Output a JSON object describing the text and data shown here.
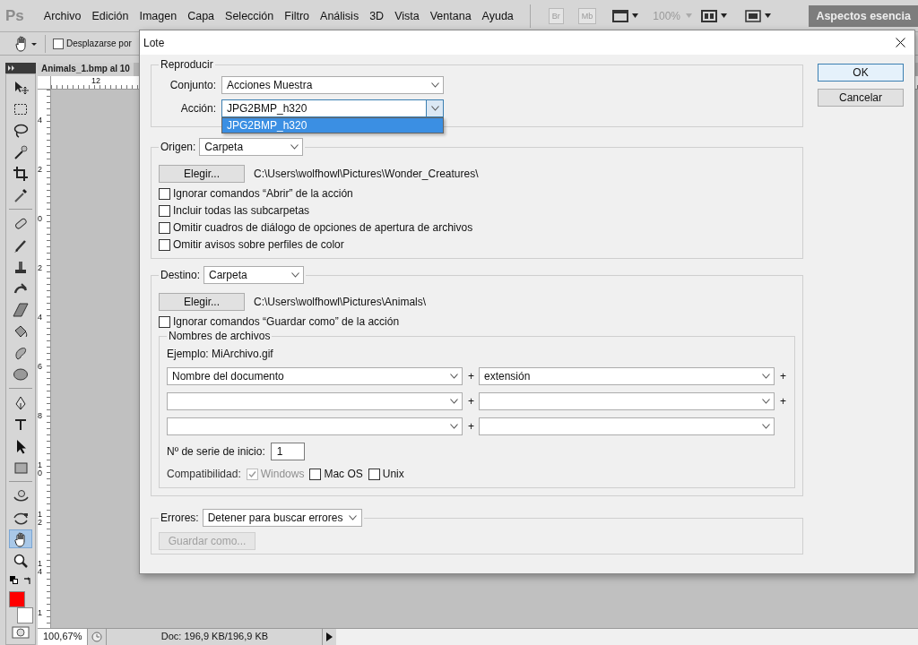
{
  "menubar": {
    "logo": "Ps",
    "menu": [
      "Archivo",
      "Edición",
      "Imagen",
      "Capa",
      "Selección",
      "Filtro",
      "Análisis",
      "3D",
      "Vista",
      "Ventana",
      "Ayuda"
    ],
    "app_buttons": [
      "Br",
      "Mb"
    ],
    "zoom": "100%",
    "workspace": "Aspectos esencia"
  },
  "options_bar": {
    "checkbox": {
      "label": "Desplazarse por",
      "checked": false
    }
  },
  "tools": [
    {
      "kind": "move",
      "selected": false
    },
    {
      "kind": "marquee",
      "selected": false
    },
    {
      "kind": "lasso",
      "selected": false
    },
    {
      "kind": "wand",
      "selected": false
    },
    {
      "kind": "crop",
      "selected": false
    },
    {
      "kind": "eyedropper",
      "selected": false
    },
    {
      "kind": "healing",
      "selected": false
    },
    {
      "kind": "brush",
      "selected": false
    },
    {
      "kind": "stamp",
      "selected": false
    },
    {
      "kind": "history",
      "selected": false
    },
    {
      "kind": "eraser",
      "selected": false
    },
    {
      "kind": "bucket",
      "selected": false
    },
    {
      "kind": "smudge",
      "selected": false
    },
    {
      "kind": "sponge",
      "selected": false
    },
    {
      "kind": "pen",
      "selected": false
    },
    {
      "kind": "type",
      "selected": false
    },
    {
      "kind": "path-select",
      "selected": false
    },
    {
      "kind": "shape",
      "selected": false
    },
    {
      "kind": "rotate3d",
      "selected": false
    },
    {
      "kind": "orbit3d",
      "selected": false
    },
    {
      "kind": "hand",
      "selected": true
    },
    {
      "kind": "zoom",
      "selected": false
    }
  ],
  "swatches": [
    {
      "kind": "foreground",
      "color": "#ff0000"
    },
    {
      "kind": "background",
      "color": "#ffffff"
    }
  ],
  "document": {
    "tab": "Animals_1.bmp al 10",
    "top_ruler": [
      "12"
    ],
    "left_ruler": [
      "4",
      "2",
      "0",
      "2",
      "4",
      "6",
      "8",
      "10",
      "12",
      "14",
      "1"
    ],
    "zoom": "100,67%",
    "doc_size": "Doc: 196,9 KB/196,9 KB"
  },
  "dialog": {
    "title": "Lote",
    "buttons": [
      "OK",
      "Cancelar"
    ],
    "reproducir": {
      "title": "Reproducir",
      "conjunto": {
        "label": "Conjunto:",
        "value": "Acciones Muestra"
      },
      "accion": {
        "label": "Acción:",
        "value": "JPG2BMP_h320",
        "open": true,
        "options": [
          {
            "label": "JPG2BMP_h320",
            "selected": true
          }
        ]
      }
    },
    "origen": {
      "label": "Origen:",
      "value": "Carpeta",
      "choose": "Elegir...",
      "path": "C:\\Users\\wolfhowl\\Pictures\\Wonder_Creatures\\",
      "options": [
        {
          "label": "Ignorar comandos “Abrir” de la acción",
          "checked": false
        },
        {
          "label": "Incluir todas las subcarpetas",
          "checked": false
        },
        {
          "label": "Omitir cuadros de diálogo de opciones de apertura de archivos",
          "checked": false
        },
        {
          "label": "Omitir avisos sobre perfiles de color",
          "checked": false
        }
      ]
    },
    "destino": {
      "label": "Destino:",
      "value": "Carpeta",
      "choose": "Elegir...",
      "path": "C:\\Users\\wolfhowl\\Pictures\\Animals\\",
      "options": [
        {
          "label": "Ignorar comandos “Guardar como” de la acción",
          "checked": false
        }
      ],
      "names": {
        "title": "Nombres de archivos",
        "example": "Ejemplo: MiArchivo.gif",
        "rows": [
          {
            "fields": [
              {
                "kind": "dropdown",
                "value": "Nombre del documento"
              },
              {
                "kind": "dropdown",
                "value": "extensión"
              }
            ],
            "separators": [
              "+",
              "+"
            ]
          },
          {
            "fields": [
              {
                "kind": "dropdown"
              },
              {
                "kind": "dropdown"
              }
            ],
            "separators": [
              "+",
              "+"
            ]
          },
          {
            "fields": [
              {
                "kind": "dropdown"
              },
              {
                "kind": "dropdown"
              }
            ],
            "separators": [
              "+"
            ]
          }
        ],
        "serial": {
          "label": "Nº de serie de inicio:",
          "value": "1"
        },
        "compat": {
          "label": "Compatibilidad:",
          "options": [
            {
              "label": "Windows",
              "checked": true,
              "disabled": true
            },
            {
              "label": "Mac OS",
              "checked": false,
              "disabled": false
            },
            {
              "label": "Unix",
              "checked": false,
              "disabled": false
            }
          ]
        }
      }
    },
    "errores": {
      "label": "Errores:",
      "value": "Detener para buscar errores",
      "save": {
        "label": "Guardar como...",
        "disabled": true
      }
    }
  }
}
